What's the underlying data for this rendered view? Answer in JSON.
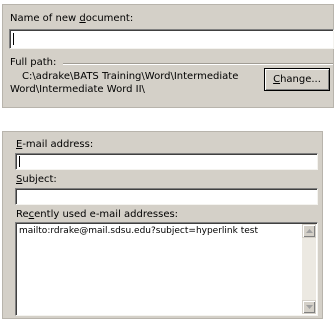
{
  "save_panel": {
    "name_label": "Name of new ",
    "name_label_underlined": "d",
    "name_label_rest": "ocument:",
    "name_value": "",
    "full_path_label": "Full path:",
    "full_path_line1": "C:\\adrake\\BATS Training\\Word\\Intermediate",
    "full_path_line2": "Word\\Intermediate Word II\\",
    "change_button_underlined": "C",
    "change_button_rest": "hange..."
  },
  "email_panel": {
    "email_label_underlined": "E",
    "email_label_rest": "-mail address:",
    "email_value": "",
    "subject_label_underlined": "S",
    "subject_label_rest": "ubject:",
    "subject_value": "",
    "recent_label_prefix": "Re",
    "recent_label_underlined": "c",
    "recent_label_rest": "ently used e-mail addresses:",
    "recent_items": [
      "mailto:rdrake@mail.sdsu.edu?subject=hyperlink test"
    ]
  }
}
